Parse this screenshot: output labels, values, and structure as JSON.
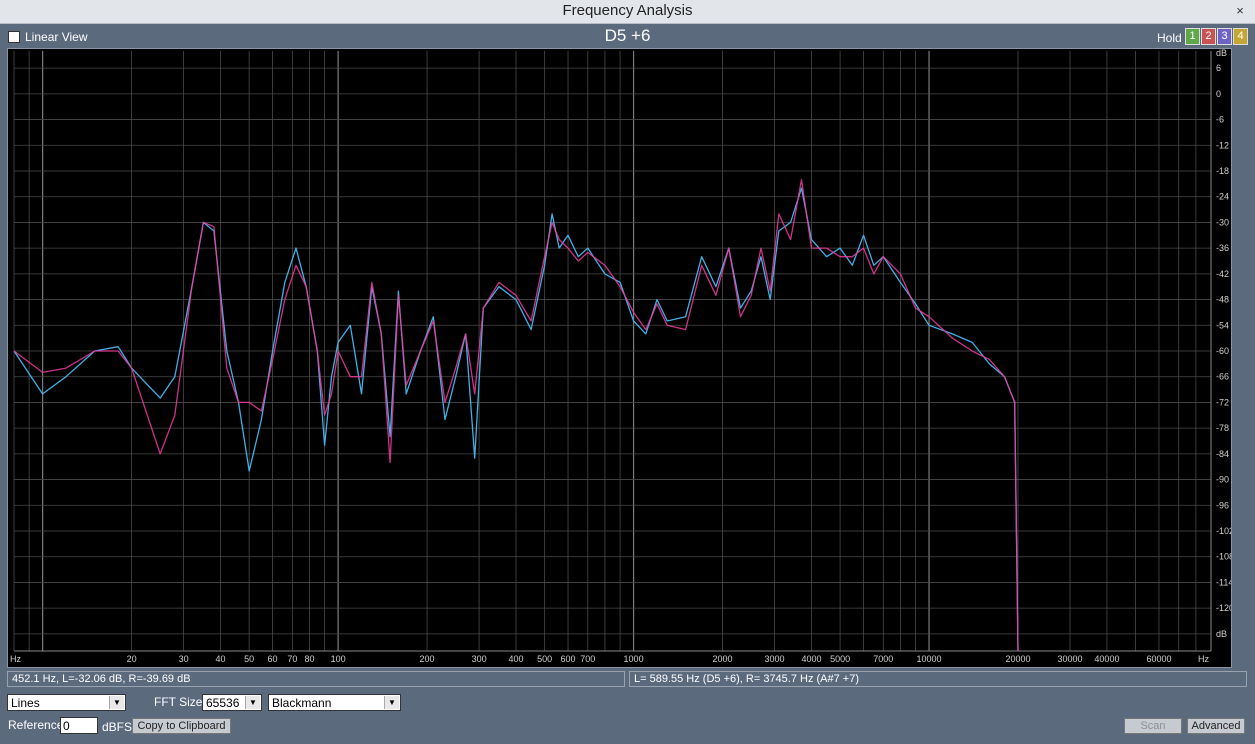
{
  "window": {
    "title": "Frequency Analysis",
    "close_glyph": "×"
  },
  "header": {
    "linear_view_label": "Linear View",
    "note": "D5 +6",
    "hold_label": "Hold",
    "hold_buttons": [
      {
        "label": "1",
        "color": "#5fa84a"
      },
      {
        "label": "2",
        "color": "#c95252"
      },
      {
        "label": "3",
        "color": "#6e63c2"
      },
      {
        "label": "4",
        "color": "#c4a635"
      }
    ]
  },
  "plot": {
    "left_unit": "Hz",
    "right_unit": "Hz",
    "db_unit": "dB",
    "x_labels": [
      {
        "f": 20,
        "t": "20"
      },
      {
        "f": 30,
        "t": "30"
      },
      {
        "f": 40,
        "t": "40"
      },
      {
        "f": 50,
        "t": "50"
      },
      {
        "f": 60,
        "t": "60"
      },
      {
        "f": 70,
        "t": "70"
      },
      {
        "f": 80,
        "t": "80"
      },
      {
        "f": 100,
        "t": "100"
      },
      {
        "f": 200,
        "t": "200"
      },
      {
        "f": 300,
        "t": "300"
      },
      {
        "f": 400,
        "t": "400"
      },
      {
        "f": 500,
        "t": "500"
      },
      {
        "f": 600,
        "t": "600"
      },
      {
        "f": 700,
        "t": "700"
      },
      {
        "f": 1000,
        "t": "1000"
      },
      {
        "f": 2000,
        "t": "2000"
      },
      {
        "f": 3000,
        "t": "3000"
      },
      {
        "f": 4000,
        "t": "4000"
      },
      {
        "f": 5000,
        "t": "5000"
      },
      {
        "f": 7000,
        "t": "7000"
      },
      {
        "f": 10000,
        "t": "10000"
      },
      {
        "f": 20000,
        "t": "20000"
      },
      {
        "f": 30000,
        "t": "30000"
      },
      {
        "f": 40000,
        "t": "40000"
      },
      {
        "f": 60000,
        "t": "60000"
      }
    ],
    "y_labels": [
      "6",
      "0",
      "-6",
      "-12",
      "-18",
      "-24",
      "-30",
      "-36",
      "-42",
      "-48",
      "-54",
      "-60",
      "-66",
      "-72",
      "-78",
      "-84",
      "-90",
      "-96",
      "-102",
      "-108",
      "-114",
      "-120"
    ]
  },
  "chart_data": {
    "type": "line",
    "xscale": "log",
    "xlim": [
      8,
      90000
    ],
    "ylim": [
      -130,
      10
    ],
    "grid": true,
    "series": [
      {
        "color": "#44b8f0",
        "points": [
          [
            8,
            -60
          ],
          [
            10,
            -70
          ],
          [
            12,
            -66
          ],
          [
            15,
            -60
          ],
          [
            18,
            -59
          ],
          [
            20,
            -64
          ],
          [
            25,
            -71
          ],
          [
            28,
            -66
          ],
          [
            32,
            -45
          ],
          [
            35,
            -30
          ],
          [
            38,
            -32
          ],
          [
            42,
            -60
          ],
          [
            46,
            -72
          ],
          [
            50,
            -88
          ],
          [
            55,
            -76
          ],
          [
            60,
            -60
          ],
          [
            66,
            -44
          ],
          [
            72,
            -36
          ],
          [
            78,
            -45
          ],
          [
            85,
            -60
          ],
          [
            90,
            -82
          ],
          [
            95,
            -66
          ],
          [
            100,
            -58
          ],
          [
            110,
            -54
          ],
          [
            120,
            -70
          ],
          [
            130,
            -45
          ],
          [
            140,
            -56
          ],
          [
            150,
            -80
          ],
          [
            160,
            -46
          ],
          [
            170,
            -70
          ],
          [
            190,
            -60
          ],
          [
            210,
            -52
          ],
          [
            230,
            -76
          ],
          [
            250,
            -66
          ],
          [
            270,
            -56
          ],
          [
            290,
            -85
          ],
          [
            310,
            -50
          ],
          [
            350,
            -45
          ],
          [
            400,
            -48
          ],
          [
            450,
            -55
          ],
          [
            500,
            -40
          ],
          [
            530,
            -28
          ],
          [
            560,
            -36
          ],
          [
            600,
            -33
          ],
          [
            650,
            -38
          ],
          [
            700,
            -36
          ],
          [
            800,
            -42
          ],
          [
            900,
            -44
          ],
          [
            1000,
            -53
          ],
          [
            1100,
            -56
          ],
          [
            1200,
            -48
          ],
          [
            1300,
            -53
          ],
          [
            1500,
            -52
          ],
          [
            1700,
            -38
          ],
          [
            1900,
            -45
          ],
          [
            2100,
            -36
          ],
          [
            2300,
            -50
          ],
          [
            2500,
            -46
          ],
          [
            2700,
            -38
          ],
          [
            2900,
            -48
          ],
          [
            3100,
            -32
          ],
          [
            3400,
            -30
          ],
          [
            3700,
            -22
          ],
          [
            4000,
            -34
          ],
          [
            4500,
            -38
          ],
          [
            5000,
            -36
          ],
          [
            5500,
            -40
          ],
          [
            6000,
            -33
          ],
          [
            6500,
            -40
          ],
          [
            7000,
            -38
          ],
          [
            8000,
            -44
          ],
          [
            9000,
            -49
          ],
          [
            10000,
            -54
          ],
          [
            12000,
            -56
          ],
          [
            14000,
            -58
          ],
          [
            16000,
            -63
          ],
          [
            18000,
            -66
          ],
          [
            19500,
            -72
          ],
          [
            20000,
            -130
          ]
        ]
      },
      {
        "color": "#f03ca0",
        "points": [
          [
            8,
            -60
          ],
          [
            10,
            -65
          ],
          [
            12,
            -64
          ],
          [
            15,
            -60
          ],
          [
            18,
            -60
          ],
          [
            20,
            -64
          ],
          [
            25,
            -84
          ],
          [
            28,
            -75
          ],
          [
            32,
            -45
          ],
          [
            35,
            -30
          ],
          [
            38,
            -31
          ],
          [
            42,
            -64
          ],
          [
            46,
            -72
          ],
          [
            50,
            -72
          ],
          [
            55,
            -74
          ],
          [
            60,
            -62
          ],
          [
            66,
            -48
          ],
          [
            72,
            -40
          ],
          [
            78,
            -45
          ],
          [
            85,
            -60
          ],
          [
            90,
            -75
          ],
          [
            95,
            -70
          ],
          [
            100,
            -60
          ],
          [
            110,
            -66
          ],
          [
            120,
            -66
          ],
          [
            130,
            -44
          ],
          [
            140,
            -56
          ],
          [
            150,
            -86
          ],
          [
            160,
            -47
          ],
          [
            170,
            -68
          ],
          [
            190,
            -60
          ],
          [
            210,
            -53
          ],
          [
            230,
            -72
          ],
          [
            250,
            -64
          ],
          [
            270,
            -56
          ],
          [
            290,
            -70
          ],
          [
            310,
            -50
          ],
          [
            350,
            -44
          ],
          [
            400,
            -47
          ],
          [
            450,
            -53
          ],
          [
            500,
            -38
          ],
          [
            530,
            -30
          ],
          [
            560,
            -34
          ],
          [
            600,
            -36
          ],
          [
            650,
            -39
          ],
          [
            700,
            -37
          ],
          [
            800,
            -40
          ],
          [
            900,
            -45
          ],
          [
            1000,
            -51
          ],
          [
            1100,
            -55
          ],
          [
            1200,
            -49
          ],
          [
            1300,
            -54
          ],
          [
            1500,
            -55
          ],
          [
            1700,
            -40
          ],
          [
            1900,
            -47
          ],
          [
            2100,
            -36
          ],
          [
            2300,
            -52
          ],
          [
            2500,
            -47
          ],
          [
            2700,
            -36
          ],
          [
            2900,
            -46
          ],
          [
            3100,
            -28
          ],
          [
            3400,
            -34
          ],
          [
            3700,
            -20
          ],
          [
            4000,
            -36
          ],
          [
            4500,
            -36
          ],
          [
            5000,
            -38
          ],
          [
            5500,
            -38
          ],
          [
            6000,
            -36
          ],
          [
            6500,
            -42
          ],
          [
            7000,
            -38
          ],
          [
            8000,
            -42
          ],
          [
            9000,
            -50
          ],
          [
            10000,
            -52
          ],
          [
            12000,
            -57
          ],
          [
            14000,
            -60
          ],
          [
            16000,
            -62
          ],
          [
            18000,
            -66
          ],
          [
            19500,
            -72
          ],
          [
            20000,
            -130
          ]
        ]
      }
    ]
  },
  "status": {
    "left": "452.1 Hz, L=-32.06 dB, R=-39.69 dB",
    "right": "L= 589.55 Hz (D5 +6), R= 3745.7 Hz (A#7 +7)"
  },
  "controls": {
    "mode": "Lines",
    "fft_label": "FFT Size",
    "fft_size": "65536",
    "window": "Blackmann",
    "reference_label": "Reference",
    "reference_value": "0",
    "dbfs_label": "dBFS",
    "copy_button": "Copy to Clipboard",
    "scan_button": "Scan",
    "advanced_button": "Advanced"
  }
}
